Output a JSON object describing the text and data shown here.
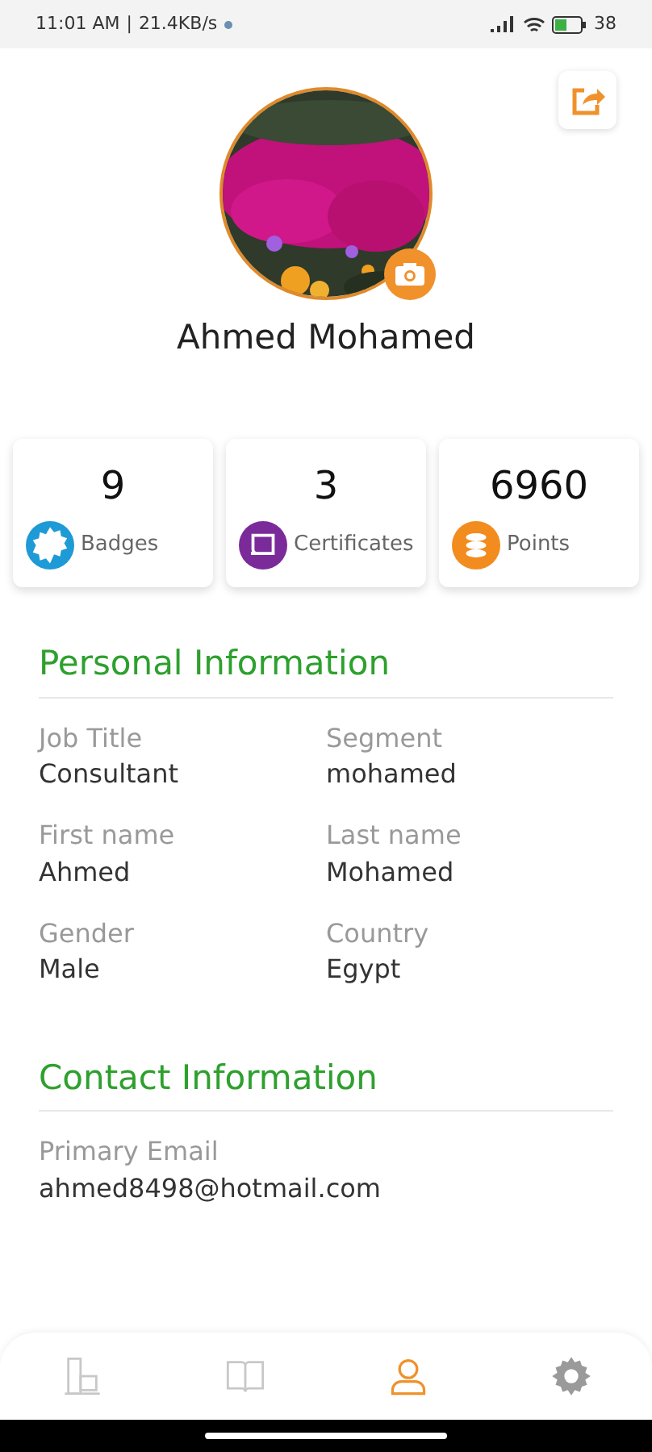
{
  "status_bar": {
    "time": "11:01 AM",
    "separator": "|",
    "speed": "21.4KB/s",
    "battery": "38"
  },
  "profile": {
    "name": "Ahmed Mohamed"
  },
  "stats": [
    {
      "value": "9",
      "label": "Badges",
      "kind": "badge",
      "color": "#1e9ad6"
    },
    {
      "value": "3",
      "label": "Certificates",
      "kind": "certificate",
      "color": "#7b2a9a"
    },
    {
      "value": "6960",
      "label": "Points",
      "kind": "coins",
      "color": "#f28c1e"
    }
  ],
  "sections": [
    {
      "title": "Personal Information",
      "fields": [
        {
          "label": "Job Title",
          "value": "Consultant"
        },
        {
          "label": "Segment",
          "value": "mohamed"
        },
        {
          "label": "First name",
          "value": "Ahmed"
        },
        {
          "label": "Last name",
          "value": "Mohamed"
        },
        {
          "label": "Gender",
          "value": "Male"
        },
        {
          "label": "Country",
          "value": "Egypt"
        }
      ],
      "kind": "grid"
    },
    {
      "title": "Contact Information",
      "fields": [
        {
          "label": "Primary Email",
          "value": "ahmed8498@hotmail.com"
        }
      ],
      "kind": "list"
    }
  ],
  "bottom_nav": [
    {
      "kind": "buildings",
      "selected": false
    },
    {
      "kind": "book",
      "selected": false
    },
    {
      "kind": "person",
      "selected": true
    },
    {
      "kind": "gear",
      "selected": false
    }
  ]
}
